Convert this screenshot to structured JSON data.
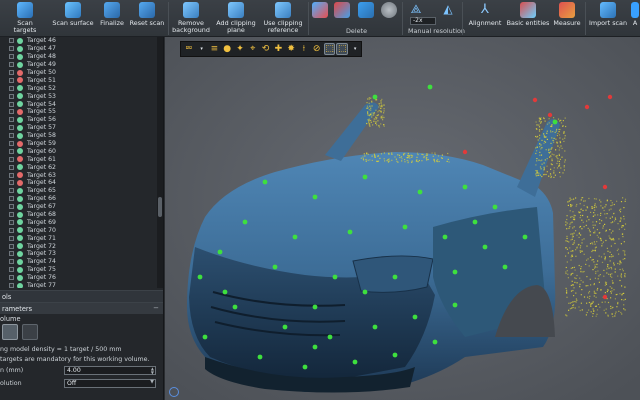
{
  "ribbon": {
    "buttons": [
      {
        "label": "Scan targets",
        "icon": "scan-targets-icon"
      },
      {
        "label": "Scan surface",
        "icon": "scan-surface-icon"
      },
      {
        "label": "Finalize",
        "icon": "finalize-icon"
      },
      {
        "label": "Reset scan",
        "icon": "reset-scan-icon"
      },
      {
        "label": "Remove\nbackground",
        "icon": "remove-background-icon"
      },
      {
        "label": "Add clipping\nplane",
        "icon": "add-clipping-plane-icon"
      },
      {
        "label": "Use clipping\nreference",
        "icon": "use-clipping-reference-icon"
      },
      {
        "label": "Alignment",
        "icon": "alignment-icon"
      },
      {
        "label": "Basic entities",
        "icon": "basic-entities-icon"
      },
      {
        "label": "Measure",
        "icon": "measure-icon"
      },
      {
        "label": "Import scan",
        "icon": "import-scan-icon"
      },
      {
        "label": "A",
        "icon": "overflow-icon"
      }
    ],
    "groups": {
      "delete": "Delete",
      "manual_resolution": "Manual resolution"
    },
    "resolution_value": "-2x"
  },
  "tree": {
    "items": [
      {
        "name": "Target 46",
        "color": "#6fd4a0"
      },
      {
        "name": "Target 47",
        "color": "#6fd4a0"
      },
      {
        "name": "Target 48",
        "color": "#6fd4a0"
      },
      {
        "name": "Target 49",
        "color": "#6fd4a0"
      },
      {
        "name": "Target 50",
        "color": "#e36a6a"
      },
      {
        "name": "Target 51",
        "color": "#e36a6a"
      },
      {
        "name": "Target 52",
        "color": "#6fd4a0"
      },
      {
        "name": "Target 53",
        "color": "#6fd4a0"
      },
      {
        "name": "Target 54",
        "color": "#6fd4a0"
      },
      {
        "name": "Target 55",
        "color": "#e36a6a"
      },
      {
        "name": "Target 56",
        "color": "#6fd4a0"
      },
      {
        "name": "Target 57",
        "color": "#6fd4a0"
      },
      {
        "name": "Target 58",
        "color": "#6fd4a0"
      },
      {
        "name": "Target 59",
        "color": "#e36a6a"
      },
      {
        "name": "Target 60",
        "color": "#6fd4a0"
      },
      {
        "name": "Target 61",
        "color": "#e36a6a"
      },
      {
        "name": "Target 62",
        "color": "#6fd4a0"
      },
      {
        "name": "Target 63",
        "color": "#e36a6a"
      },
      {
        "name": "Target 64",
        "color": "#e36a6a"
      },
      {
        "name": "Target 65",
        "color": "#6fd4a0"
      },
      {
        "name": "Target 66",
        "color": "#6fd4a0"
      },
      {
        "name": "Target 67",
        "color": "#6fd4a0"
      },
      {
        "name": "Target 68",
        "color": "#6fd4a0"
      },
      {
        "name": "Target 69",
        "color": "#6fd4a0"
      },
      {
        "name": "Target 70",
        "color": "#6fd4a0"
      },
      {
        "name": "Target 71",
        "color": "#6fd4a0"
      },
      {
        "name": "Target 72",
        "color": "#6fd4a0"
      },
      {
        "name": "Target 73",
        "color": "#6fd4a0"
      },
      {
        "name": "Target 74",
        "color": "#6fd4a0"
      },
      {
        "name": "Target 75",
        "color": "#6fd4a0"
      },
      {
        "name": "Target 76",
        "color": "#6fd4a0"
      },
      {
        "name": "Target 77",
        "color": "#6fd4a0"
      }
    ]
  },
  "panels": {
    "tools_title": "ols",
    "params_title": "rameters"
  },
  "params": {
    "volume_label": "olume",
    "density_note": "ng model density = 1 target / 500 mm",
    "mandatory_note": "targets are mandatory for this working volume.",
    "size_label": "n (mm)",
    "size_value": "4.00",
    "resolution_label": "olution",
    "resolution_value": "Off"
  },
  "colors": {
    "car_body": "#3f6e96",
    "target_green": "#3ee03e",
    "target_red": "#e23a3a",
    "point_cloud_yellow": "#d8cf3a",
    "background": "#5b5f66"
  }
}
